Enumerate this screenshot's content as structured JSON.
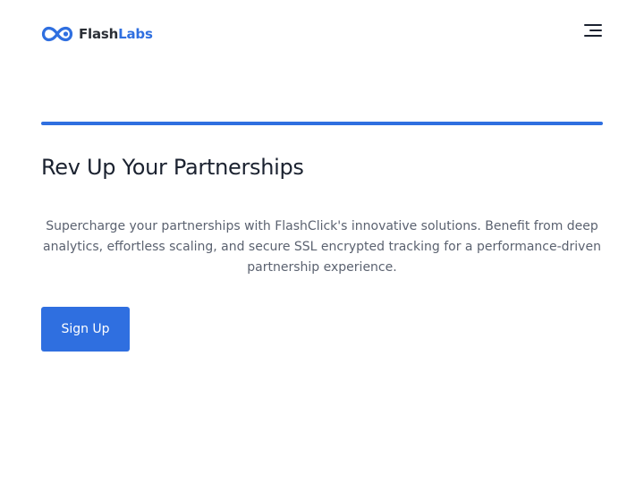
{
  "header": {
    "logo_icon": "infinity-logo-icon",
    "logo_text_part1": "Flash",
    "logo_text_part2": "Labs",
    "menu_icon": "hamburger-menu-icon"
  },
  "hero": {
    "title": "Rev Up Your Partnerships",
    "description": "Supercharge your partnerships with FlashClick's innovative solutions. Benefit from deep analytics, effortless scaling, and secure SSL encrypted tracking for a performance-driven partnership experience.",
    "cta_label": "Sign Up"
  },
  "colors": {
    "accent": "#2f6fe0",
    "title_text": "#1b2230",
    "body_text": "#5b6270",
    "background": "#ffffff"
  }
}
